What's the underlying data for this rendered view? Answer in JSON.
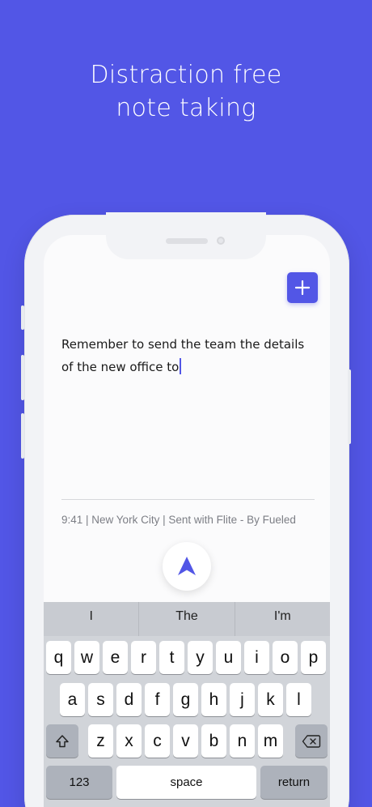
{
  "headline": {
    "line1": "Distraction free",
    "line2": "note taking"
  },
  "note": {
    "line1": "Remember to send the team the details",
    "line2": "of the new office to"
  },
  "meta": "9:41 | New York City | Sent with Flite - By Fueled",
  "icons": {
    "add": "plus-icon",
    "send": "send-arrow-icon",
    "shift": "shift-icon",
    "delete": "backspace-icon"
  },
  "colors": {
    "background": "#5256e6",
    "accent": "#5256e6"
  },
  "keyboard": {
    "suggestions": [
      "I",
      "The",
      "I'm"
    ],
    "row1": [
      "q",
      "w",
      "e",
      "r",
      "t",
      "y",
      "u",
      "i",
      "o",
      "p"
    ],
    "row2": [
      "a",
      "s",
      "d",
      "f",
      "g",
      "h",
      "j",
      "k",
      "l"
    ],
    "row3": [
      "z",
      "x",
      "c",
      "v",
      "b",
      "n",
      "m"
    ],
    "numbers_label": "123",
    "space_label": "space",
    "return_label": "return"
  }
}
